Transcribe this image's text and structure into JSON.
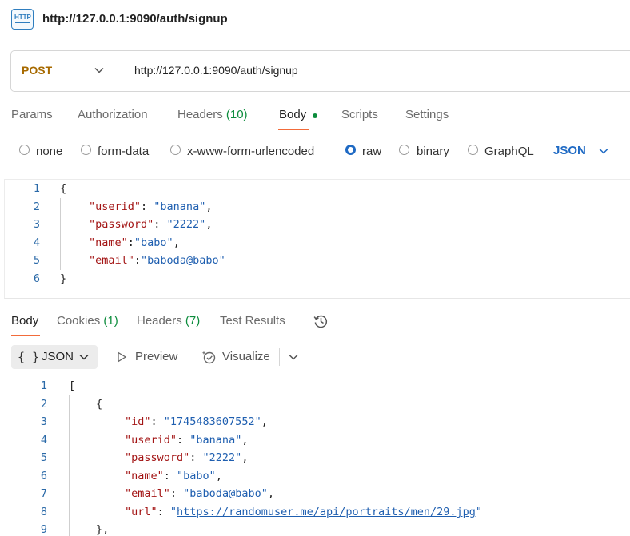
{
  "window": {
    "title": "http://127.0.0.1:9090/auth/signup",
    "badge_text": "HTTP"
  },
  "request": {
    "method": "POST",
    "url": "http://127.0.0.1:9090/auth/signup",
    "tabs": [
      {
        "label": "Params"
      },
      {
        "label": "Authorization"
      },
      {
        "label": "Headers",
        "count": "(10)"
      },
      {
        "label": "Body",
        "active": true
      },
      {
        "label": "Scripts"
      },
      {
        "label": "Settings"
      }
    ],
    "body_types": [
      "none",
      "form-data",
      "x-www-form-urlencoded",
      "raw",
      "binary",
      "GraphQL"
    ],
    "selected_body_type": "raw",
    "language": "JSON",
    "editor": {
      "line_numbers": [
        "1",
        "2",
        "3",
        "4",
        "5",
        "6"
      ],
      "lines": {
        "l1": "{",
        "l2_key": "\"userid\"",
        "l2_sep": ": ",
        "l2_val": "\"banana\"",
        "l2_end": ",",
        "l3_key": "\"password\"",
        "l3_sep": ": ",
        "l3_val": "\"2222\"",
        "l3_end": ",",
        "l4_key": "\"name\"",
        "l4_sep": ":",
        "l4_val": "\"babo\"",
        "l4_end": ",",
        "l5_key": "\"email\"",
        "l5_sep": ":",
        "l5_val": "\"baboda@babo\"",
        "l6": "}"
      }
    }
  },
  "response": {
    "tabs": [
      {
        "label": "Body",
        "active": true
      },
      {
        "label": "Cookies",
        "count": "(1)"
      },
      {
        "label": "Headers",
        "count": "(7)"
      },
      {
        "label": "Test Results"
      }
    ],
    "format": {
      "brace": "{ }",
      "label": "JSON"
    },
    "preview_label": "Preview",
    "visualize_label": "Visualize",
    "viewer": {
      "line_numbers": [
        "1",
        "2",
        "3",
        "4",
        "5",
        "6",
        "7",
        "8",
        "9"
      ],
      "lines": {
        "l1": "[",
        "l2": "{",
        "l3_key": "\"id\"",
        "l3_val": "\"1745483607552\"",
        "l4_key": "\"userid\"",
        "l4_val": "\"banana\"",
        "l5_key": "\"password\"",
        "l5_val": "\"2222\"",
        "l6_key": "\"name\"",
        "l6_val": "\"babo\"",
        "l7_key": "\"email\"",
        "l7_val": "\"baboda@babo\"",
        "l8_key": "\"url\"",
        "l8_q": "\"",
        "l8_link": "https://randomuser.me/api/portraits/men/29.jpg",
        "l9": "},"
      }
    }
  },
  "colors": {
    "accent": "#f26b3a",
    "method": "#a76a00",
    "count": "#0c8c3c",
    "link": "#1f6ac4",
    "json_key": "#a31515",
    "json_string": "#1f5fb0"
  }
}
